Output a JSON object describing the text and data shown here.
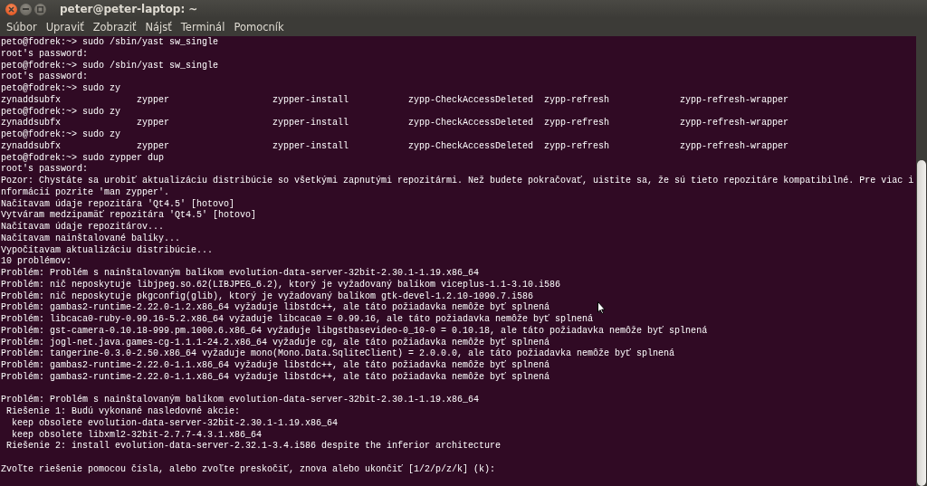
{
  "window": {
    "title": "peter@peter-laptop: ~"
  },
  "menu": [
    {
      "label": "Súbor"
    },
    {
      "label": "Upraviť"
    },
    {
      "label": "Zobraziť"
    },
    {
      "label": "Nájsť"
    },
    {
      "label": "Terminál"
    },
    {
      "label": "Pomocník"
    }
  ],
  "terminal": {
    "lines": [
      {
        "kind": "text",
        "text": "peto@fodrek:~> sudo /sbin/yast sw_single"
      },
      {
        "kind": "text",
        "text": "root's password:"
      },
      {
        "kind": "text",
        "text": "peto@fodrek:~> sudo /sbin/yast sw_single"
      },
      {
        "kind": "text",
        "text": "root's password:"
      },
      {
        "kind": "text",
        "text": "peto@fodrek:~> sudo zy"
      },
      {
        "kind": "columns",
        "items": [
          "zynaddsubfx",
          "zypper",
          "zypper-install",
          "zypp-CheckAccessDeleted",
          "zypp-refresh",
          "zypp-refresh-wrapper"
        ]
      },
      {
        "kind": "text",
        "text": "peto@fodrek:~> sudo zy"
      },
      {
        "kind": "columns",
        "items": [
          "zynaddsubfx",
          "zypper",
          "zypper-install",
          "zypp-CheckAccessDeleted",
          "zypp-refresh",
          "zypp-refresh-wrapper"
        ]
      },
      {
        "kind": "text",
        "text": "peto@fodrek:~> sudo zy"
      },
      {
        "kind": "columns",
        "items": [
          "zynaddsubfx",
          "zypper",
          "zypper-install",
          "zypp-CheckAccessDeleted",
          "zypp-refresh",
          "zypp-refresh-wrapper"
        ]
      },
      {
        "kind": "text",
        "text": "peto@fodrek:~> sudo zypper dup"
      },
      {
        "kind": "text",
        "text": "root's password:"
      },
      {
        "kind": "text",
        "text": "Pozor: Chystáte sa urobiť aktualizáciu distribúcie so všetkými zapnutými repozitármi. Než budete pokračovať, uistite sa, že sú tieto repozitáre kompatibilné. Pre viac i"
      },
      {
        "kind": "text",
        "text": "nformácií pozrite 'man zypper'."
      },
      {
        "kind": "text",
        "text": "Načítavam údaje repozitára 'Qt4.5' [hotovo]"
      },
      {
        "kind": "text",
        "text": "Vytváram medzipamäť repozitára 'Qt4.5' [hotovo]"
      },
      {
        "kind": "text",
        "text": "Načítavam údaje repozitárov..."
      },
      {
        "kind": "text",
        "text": "Načítavam nainštalované balíky..."
      },
      {
        "kind": "text",
        "text": "Vypočítavam aktualizáciu distribúcie..."
      },
      {
        "kind": "text",
        "text": "10 problémov:"
      },
      {
        "kind": "text",
        "text": "Problém: Problém s nainštalovaným balíkom evolution-data-server-32bit-2.30.1-1.19.x86_64"
      },
      {
        "kind": "text",
        "text": "Problém: nič neposkytuje libjpeg.so.62(LIBJPEG_6.2), ktorý je vyžadovaný balíkom viceplus-1.1-3.10.i586"
      },
      {
        "kind": "text",
        "text": "Problém: nič neposkytuje pkgconfig(glib), ktorý je vyžadovaný balíkom gtk-devel-1.2.10-1090.7.i586"
      },
      {
        "kind": "text",
        "text": "Problém: gambas2-runtime-2.22.0-1.2.x86_64 vyžaduje libstdc++, ale táto požiadavka nemôže byť splnená"
      },
      {
        "kind": "text",
        "text": "Problém: libcaca0-ruby-0.99.16-5.2.x86_64 vyžaduje libcaca0 = 0.99.16, ale táto požiadavka nemôže byť splnená"
      },
      {
        "kind": "text",
        "text": "Problém: gst-camera-0.10.18-999.pm.1000.6.x86_64 vyžaduje libgstbasevideo-0_10-0 = 0.10.18, ale táto požiadavka nemôže byť splnená"
      },
      {
        "kind": "text",
        "text": "Problém: jogl-net.java.games-cg-1.1.1-24.2.x86_64 vyžaduje cg, ale táto požiadavka nemôže byť splnená"
      },
      {
        "kind": "text",
        "text": "Problém: tangerine-0.3.0-2.50.x86_64 vyžaduje mono(Mono.Data.SqliteClient) = 2.0.0.0, ale táto požiadavka nemôže byť splnená"
      },
      {
        "kind": "text",
        "text": "Problém: gambas2-runtime-2.22.0-1.1.x86_64 vyžaduje libstdc++, ale táto požiadavka nemôže byť splnená"
      },
      {
        "kind": "text",
        "text": "Problém: gambas2-runtime-2.22.0-1.1.x86_64 vyžaduje libstdc++, ale táto požiadavka nemôže byť splnená"
      },
      {
        "kind": "blank"
      },
      {
        "kind": "text",
        "text": "Problém: Problém s nainštalovaným balíkom evolution-data-server-32bit-2.30.1-1.19.x86_64"
      },
      {
        "kind": "text",
        "text": " Riešenie 1: Budú vykonané nasledovné akcie:"
      },
      {
        "kind": "text",
        "text": "  keep obsolete evolution-data-server-32bit-2.30.1-1.19.x86_64"
      },
      {
        "kind": "text",
        "text": "  keep obsolete libxml2-32bit-2.7.7-4.3.1.x86_64"
      },
      {
        "kind": "text",
        "text": " Riešenie 2: install evolution-data-server-2.32.1-3.4.i586 despite the inferior architecture"
      },
      {
        "kind": "blank"
      },
      {
        "kind": "text",
        "text": "Zvoľte riešenie pomocou čísla, alebo zvoľte preskočiť, znova alebo ukončiť [1/2/p/z/k] (k):"
      }
    ]
  }
}
